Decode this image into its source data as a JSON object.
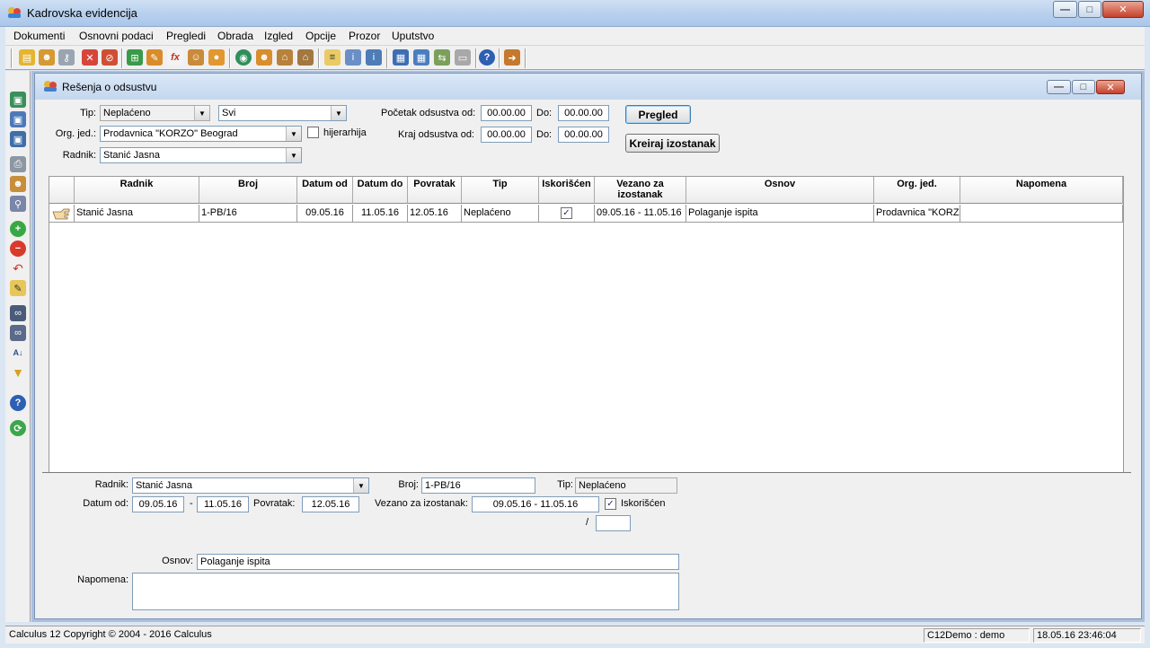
{
  "app": {
    "title": "Kadrovska evidencija",
    "window_controls": {
      "minimize": "—",
      "maximize": "□",
      "close": "✕"
    }
  },
  "menu": [
    "Dokumenti",
    "Osnovni podaci",
    "Pregledi",
    "Obrada",
    "Izgled",
    "Opcije",
    "Prozor",
    "Uputstvo"
  ],
  "toolbar_icons": [
    "folder-open-icon",
    "users-icon",
    "key-icon",
    "delete-doc-icon",
    "delete-users-icon",
    "org-chart-icon",
    "person-task-icon",
    "formula-icon",
    "org-person-icon",
    "person-icon",
    "globe-icon",
    "users-globe-icon",
    "house-icon",
    "house-alt-icon",
    "report-icon",
    "report-info-icon",
    "info-list-icon",
    "calendar-icon",
    "table-icon",
    "export-icon",
    "screen-icon",
    "help-icon",
    "exit-icon"
  ],
  "sidebar_icons": [
    "save-icon",
    "save-as-icon",
    "save-all-icon",
    "print-icon",
    "people-print-icon",
    "people-search-icon",
    "add-icon",
    "remove-icon",
    "undo-icon",
    "edit-icon",
    "binoculars-icon",
    "binoculars-next-icon",
    "sort-az-icon",
    "filter-icon",
    "help-icon",
    "refresh-icon"
  ],
  "child": {
    "title": "Rešenja o odsustvu",
    "window_controls": {
      "minimize": "—",
      "maximize": "□",
      "close": "✕"
    }
  },
  "filters": {
    "tip_label": "Tip:",
    "tip_value": "Neplaćeno",
    "tip2_value": "Svi",
    "org_label": "Org. jed.:",
    "org_value": "Prodavnica \"KORZO\" Beograd",
    "hijerarhija_label": "hijerarhija",
    "hijerarhija_checked": false,
    "radnik_label": "Radnik:",
    "radnik_value": "Stanić Jasna",
    "pocetak_label": "Početak odsustva od:",
    "pocetak_od": "00.00.00",
    "pocetak_do_label": "Do:",
    "pocetak_do": "00.00.00",
    "kraj_label": "Kraj odsustva od:",
    "kraj_od": "00.00.00",
    "kraj_do_label": "Do:",
    "kraj_do": "00.00.00",
    "pregled_button": "Pregled",
    "kreiraj_button": "Kreiraj izostanak"
  },
  "table": {
    "columns": [
      "Radnik",
      "Broj",
      "Datum od",
      "Datum do",
      "Povratak",
      "Tip",
      "Iskorišćen",
      "Vezano za izostanak",
      "Osnov",
      "Org. jed.",
      "Napomena"
    ],
    "rows": [
      {
        "radnik": "Stanić Jasna",
        "broj": "1-PB/16",
        "datum_od": "09.05.16",
        "datum_do": "11.05.16",
        "povratak": "12.05.16",
        "tip": "Neplaćeno",
        "iskoriscen": "✓",
        "vezano": "09.05.16 - 11.05.16",
        "osnov": "Polaganje ispita",
        "org": "Prodavnica \"KORZO",
        "napomena": ""
      }
    ]
  },
  "detail": {
    "radnik_label": "Radnik:",
    "radnik_value": "Stanić Jasna",
    "broj_label": "Broj:",
    "broj_value": "1-PB/16",
    "tip_label": "Tip:",
    "tip_value": "Neplaćeno",
    "datum_od_label": "Datum od:",
    "datum_od_value": "09.05.16",
    "dash": "-",
    "datum_do_value": "11.05.16",
    "povratak_label": "Povratak:",
    "povratak_value": "12.05.16",
    "vezano_label": "Vezano za izostanak:",
    "vezano_value": "09.05.16 - 11.05.16",
    "iskoriscen_label": "Iskorišćen",
    "iskoriscen_checked": true,
    "slash": "/",
    "slash_value": "",
    "osnov_label": "Osnov:",
    "osnov_value": "Polaganje ispita",
    "napomena_label": "Napomena:",
    "napomena_value": ""
  },
  "status": {
    "copyright": "Calculus 12  Copyright © 2004 - 2016  Calculus",
    "user": "C12Demo : demo",
    "datetime": "18.05.16 23:46:04"
  }
}
